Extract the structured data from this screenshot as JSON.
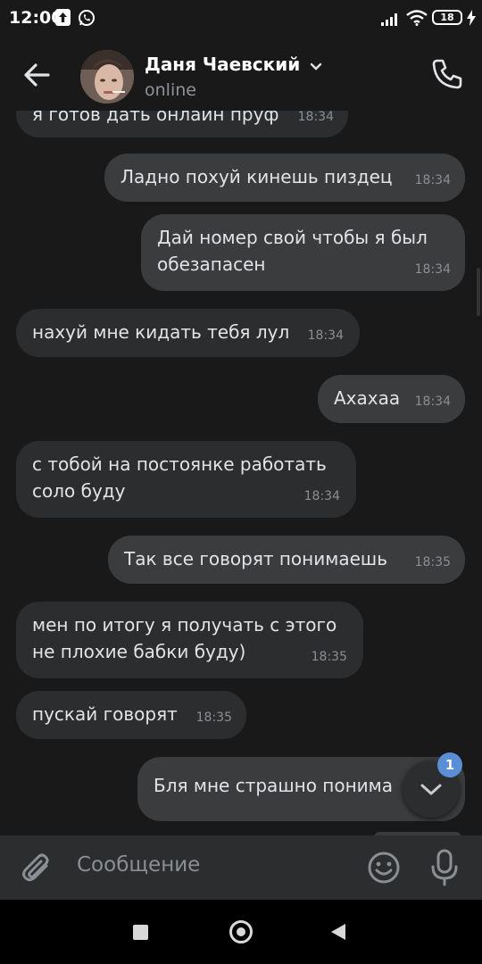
{
  "status_bar": {
    "time": "12:00",
    "icons": [
      "upload-icon",
      "whatsapp-icon",
      "signal-icon",
      "wifi-icon",
      "battery-icon",
      "charging-icon"
    ],
    "battery": "18"
  },
  "header": {
    "contact_name": "Даня Чаевский",
    "status": "online",
    "icons": [
      "back-arrow-icon",
      "chevron-down-icon",
      "phone-icon"
    ]
  },
  "messages": [
    {
      "direction": "in",
      "text": "я готов дать онлайн пруф",
      "time": "18:34"
    },
    {
      "direction": "out",
      "text": "Ладно похуй кинешь пиздец",
      "time": "18:34"
    },
    {
      "direction": "out",
      "text": "Дай номер свой чтобы я был обезапасен",
      "time": "18:34"
    },
    {
      "direction": "in",
      "text": "нахуй мне кидать тебя лул",
      "time": "18:34"
    },
    {
      "direction": "out",
      "text": "Ахахаа",
      "time": "18:34"
    },
    {
      "direction": "in",
      "text": "с тобой на постоянке работать соло буду",
      "time": "18:34"
    },
    {
      "direction": "out",
      "text": "Так все говорят понимаешь",
      "time": "18:35"
    },
    {
      "direction": "in",
      "text": "мен по итогу я получать с этого не плохие бабки буду)",
      "time": "18:35"
    },
    {
      "direction": "in",
      "text": "пускай говорят",
      "time": "18:35"
    },
    {
      "direction": "out",
      "text": "Бля мне страшно понима",
      "time": ""
    }
  ],
  "scroll_button": {
    "badge": "1",
    "icon": "chevron-down-icon"
  },
  "composer": {
    "placeholder": "Сообщение",
    "icons": [
      "paperclip-icon",
      "emoji-icon",
      "microphone-icon"
    ]
  },
  "nav": {
    "icons": [
      "recents-square-icon",
      "home-circle-icon",
      "back-triangle-icon"
    ]
  },
  "colors": {
    "background": "#19191a",
    "bubble_in": "#2c2d2e",
    "bubble_out": "#3b3c3e",
    "badge": "#5a8fd6",
    "text": "#e1e3e6",
    "secondary_text": "#8b8e92"
  }
}
